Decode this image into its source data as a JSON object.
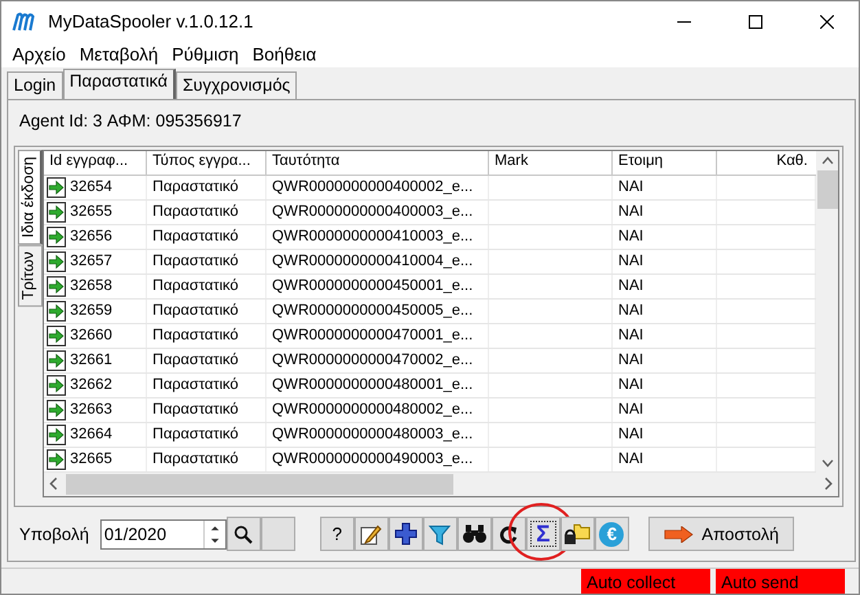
{
  "window": {
    "title": "MyDataSpooler v.1.0.12.1"
  },
  "menu": [
    "Αρχείο",
    "Μεταβολή",
    "Ρύθμιση",
    "Βοήθεια"
  ],
  "tabs": [
    {
      "label": "Login",
      "selected": false
    },
    {
      "label": "Παραστατικά",
      "selected": true
    },
    {
      "label": "Συγχρονισμός",
      "selected": false
    }
  ],
  "agent_info": "Agent Id: 3 ΑΦΜ: 095356917",
  "side_tabs": [
    {
      "label": "Ιδια έκδοση",
      "selected": true
    },
    {
      "label": "Τρίτων",
      "selected": false
    }
  ],
  "table": {
    "columns": [
      "Id εγγραφ...",
      "Τύπος εγγρα...",
      "Ταυτότητα",
      "Mark",
      "Ετοιμη",
      "Καθ."
    ],
    "rows": [
      {
        "id": "32654",
        "type": "Παραστατικό",
        "identity": "QWR0000000000400002_e...",
        "mark": "",
        "ready": "ΝΑΙ"
      },
      {
        "id": "32655",
        "type": "Παραστατικό",
        "identity": "QWR0000000000400003_e...",
        "mark": "",
        "ready": "ΝΑΙ"
      },
      {
        "id": "32656",
        "type": "Παραστατικό",
        "identity": "QWR0000000000410003_e...",
        "mark": "",
        "ready": "ΝΑΙ"
      },
      {
        "id": "32657",
        "type": "Παραστατικό",
        "identity": "QWR0000000000410004_e...",
        "mark": "",
        "ready": "ΝΑΙ"
      },
      {
        "id": "32658",
        "type": "Παραστατικό",
        "identity": "QWR0000000000450001_e...",
        "mark": "",
        "ready": "ΝΑΙ"
      },
      {
        "id": "32659",
        "type": "Παραστατικό",
        "identity": "QWR0000000000450005_e...",
        "mark": "",
        "ready": "ΝΑΙ"
      },
      {
        "id": "32660",
        "type": "Παραστατικό",
        "identity": "QWR0000000000470001_e...",
        "mark": "",
        "ready": "ΝΑΙ"
      },
      {
        "id": "32661",
        "type": "Παραστατικό",
        "identity": "QWR0000000000470002_e...",
        "mark": "",
        "ready": "ΝΑΙ"
      },
      {
        "id": "32662",
        "type": "Παραστατικό",
        "identity": "QWR0000000000480001_e...",
        "mark": "",
        "ready": "ΝΑΙ"
      },
      {
        "id": "32663",
        "type": "Παραστατικό",
        "identity": "QWR0000000000480002_e...",
        "mark": "",
        "ready": "ΝΑΙ"
      },
      {
        "id": "32664",
        "type": "Παραστατικό",
        "identity": "QWR0000000000480003_e...",
        "mark": "",
        "ready": "ΝΑΙ"
      },
      {
        "id": "32665",
        "type": "Παραστατικό",
        "identity": "QWR0000000000490003_e...",
        "mark": "",
        "ready": "ΝΑΙ"
      }
    ]
  },
  "toolbar": {
    "period_label": "Υποβολή",
    "period_value": "01/2020",
    "tools": [
      {
        "kind": "help",
        "label": "?"
      },
      {
        "kind": "edit"
      },
      {
        "kind": "add"
      },
      {
        "kind": "filter"
      },
      {
        "kind": "find"
      },
      {
        "kind": "refresh"
      },
      {
        "kind": "sum",
        "label": "Σ",
        "highlighted": true
      },
      {
        "kind": "folder"
      },
      {
        "kind": "euro",
        "label": "€"
      }
    ],
    "send_button": "Αποστολή"
  },
  "status_bar": [
    {
      "label": "Auto collect",
      "color": "#ff0000"
    },
    {
      "label": "Auto send",
      "color": "#ff0000"
    }
  ]
}
